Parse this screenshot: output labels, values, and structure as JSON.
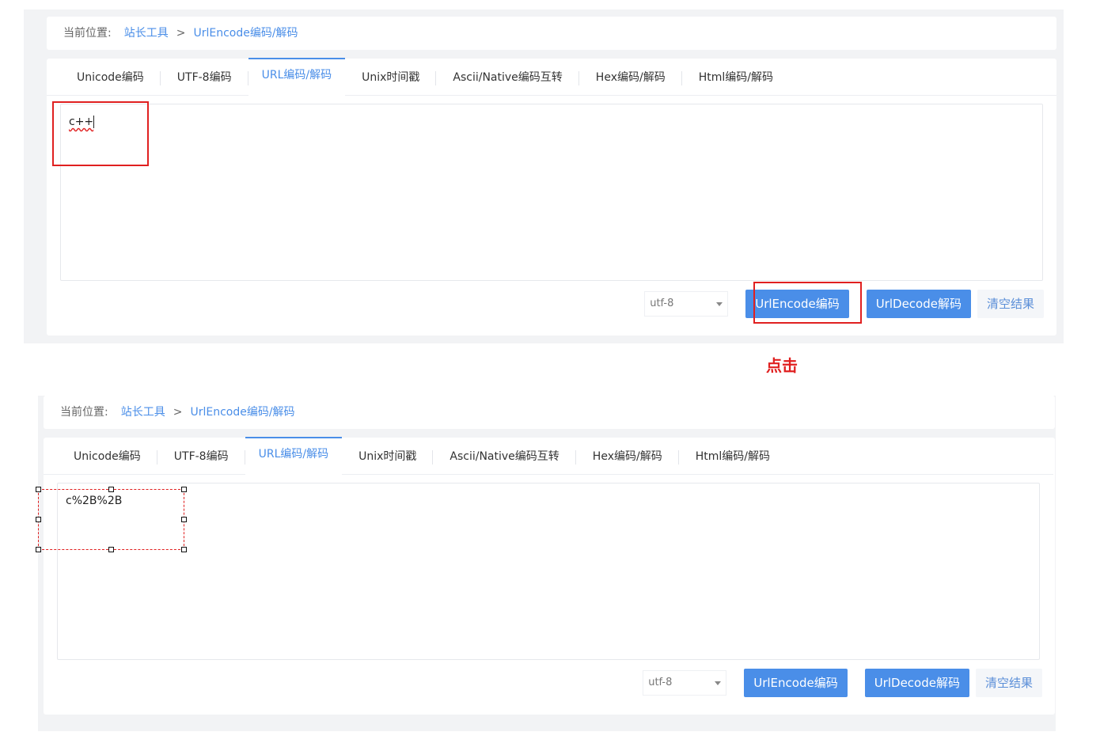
{
  "breadcrumb": {
    "label": "当前位置:",
    "root": "站长工具",
    "separator": ">",
    "current": "UrlEncode编码/解码"
  },
  "tabs": [
    {
      "label": "Unicode编码"
    },
    {
      "label": "UTF-8编码"
    },
    {
      "label": "URL编码/解码",
      "active": true
    },
    {
      "label": "Unix时间戳"
    },
    {
      "label": "Ascii/Native编码互转"
    },
    {
      "label": "Hex编码/解码"
    },
    {
      "label": "Html编码/解码"
    }
  ],
  "before": {
    "input_value": "c++"
  },
  "after": {
    "input_value": "c%2B%2B"
  },
  "toolbar": {
    "charset": "utf-8",
    "encode_label": "UrlEncode编码",
    "decode_label": "UrlDecode解码",
    "clear_label": "清空结果"
  },
  "annotation": {
    "click_label": "点击"
  },
  "colors": {
    "accent": "#4a8ee8",
    "highlight": "#e02020"
  }
}
